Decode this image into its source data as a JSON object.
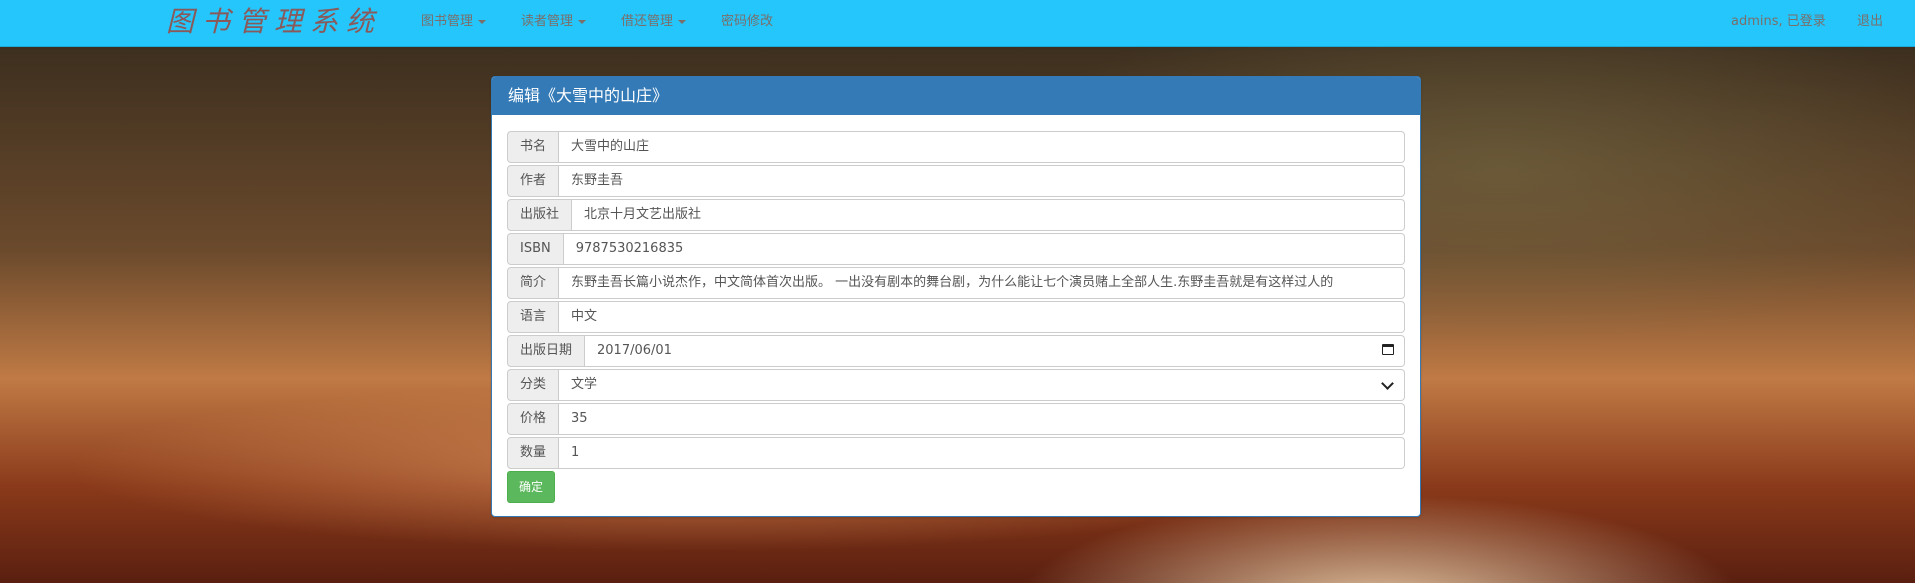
{
  "nav": {
    "brand": "图书管理系统",
    "menu": [
      {
        "label": "图书管理"
      },
      {
        "label": "读者管理"
      },
      {
        "label": "借还管理"
      },
      {
        "label": "密码修改"
      }
    ],
    "user_status": "admins, 已登录",
    "logout": "退出"
  },
  "panel": {
    "title": "编辑《大雪中的山庄》",
    "fields": {
      "title": {
        "label": "书名",
        "value": "大雪中的山庄"
      },
      "author": {
        "label": "作者",
        "value": "东野圭吾"
      },
      "publisher": {
        "label": "出版社",
        "value": "北京十月文艺出版社"
      },
      "isbn": {
        "label": "ISBN",
        "value": "9787530216835"
      },
      "intro": {
        "label": "简介",
        "value": "东野圭吾长篇小说杰作，中文简体首次出版。 一出没有剧本的舞台剧，为什么能让七个演员赌上全部人生.东野圭吾就是有这样过人的"
      },
      "language": {
        "label": "语言",
        "value": "中文"
      },
      "pub_date": {
        "label": "出版日期",
        "value": "2017/06/01"
      },
      "category": {
        "label": "分类",
        "value": "文学"
      },
      "price": {
        "label": "价格",
        "value": "35"
      },
      "quantity": {
        "label": "数量",
        "value": "1"
      }
    },
    "submit": "确定"
  }
}
